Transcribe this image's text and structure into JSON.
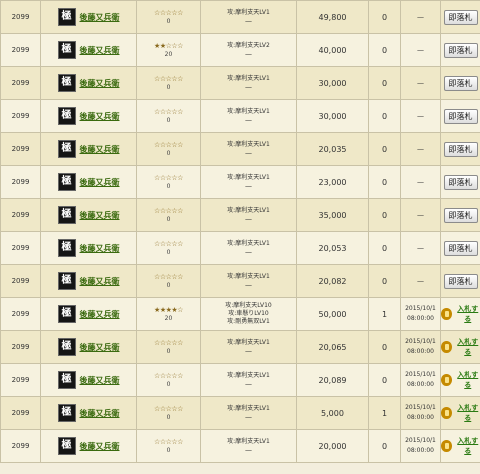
{
  "card_glyph": "極",
  "card_name": "後藤又兵衛",
  "buy_label": "即落札",
  "bid_label": "入札する",
  "rows": [
    {
      "id": "2099",
      "stars": "☆☆☆☆☆",
      "star_count": "0",
      "skills": [
        "攻:摩利支天LV1"
      ],
      "skill_extra": "—",
      "price": "49,800",
      "bids": "0",
      "deadline": "—",
      "deadline_time": "",
      "action": "buy"
    },
    {
      "id": "2099",
      "stars": "★★☆☆☆",
      "star_count": "20",
      "skills": [
        "攻:摩利支天LV2"
      ],
      "skill_extra": "—",
      "price": "40,000",
      "bids": "0",
      "deadline": "—",
      "deadline_time": "",
      "action": "buy"
    },
    {
      "id": "2099",
      "stars": "☆☆☆☆☆",
      "star_count": "0",
      "skills": [
        "攻:摩利支天LV1"
      ],
      "skill_extra": "—",
      "price": "30,000",
      "bids": "0",
      "deadline": "—",
      "deadline_time": "",
      "action": "buy"
    },
    {
      "id": "2099",
      "stars": "☆☆☆☆☆",
      "star_count": "0",
      "skills": [
        "攻:摩利支天LV1"
      ],
      "skill_extra": "—",
      "price": "30,000",
      "bids": "0",
      "deadline": "—",
      "deadline_time": "",
      "action": "buy"
    },
    {
      "id": "2099",
      "stars": "☆☆☆☆☆",
      "star_count": "0",
      "skills": [
        "攻:摩利支天LV1"
      ],
      "skill_extra": "—",
      "price": "20,035",
      "bids": "0",
      "deadline": "—",
      "deadline_time": "",
      "action": "buy"
    },
    {
      "id": "2099",
      "stars": "☆☆☆☆☆",
      "star_count": "0",
      "skills": [
        "攻:摩利支天LV1"
      ],
      "skill_extra": "—",
      "price": "23,000",
      "bids": "0",
      "deadline": "—",
      "deadline_time": "",
      "action": "buy"
    },
    {
      "id": "2099",
      "stars": "☆☆☆☆☆",
      "star_count": "0",
      "skills": [
        "攻:摩利支天LV1"
      ],
      "skill_extra": "—",
      "price": "35,000",
      "bids": "0",
      "deadline": "—",
      "deadline_time": "",
      "action": "buy"
    },
    {
      "id": "2099",
      "stars": "☆☆☆☆☆",
      "star_count": "0",
      "skills": [
        "攻:摩利支天LV1"
      ],
      "skill_extra": "—",
      "price": "20,053",
      "bids": "0",
      "deadline": "—",
      "deadline_time": "",
      "action": "buy"
    },
    {
      "id": "2099",
      "stars": "☆☆☆☆☆",
      "star_count": "0",
      "skills": [
        "攻:摩利支天LV1"
      ],
      "skill_extra": "—",
      "price": "20,082",
      "bids": "0",
      "deadline": "—",
      "deadline_time": "",
      "action": "buy"
    },
    {
      "id": "2099",
      "stars": "★★★★☆",
      "star_count": "20",
      "skills": [
        "攻:摩利支天LV10",
        "攻:車懸りLV10",
        "攻:剛勇無双LV1"
      ],
      "skill_extra": "",
      "price": "50,000",
      "bids": "1",
      "deadline": "2015/10/1",
      "deadline_time": "08:00:00",
      "action": "bid"
    },
    {
      "id": "2099",
      "stars": "☆☆☆☆☆",
      "star_count": "0",
      "skills": [
        "攻:摩利支天LV1"
      ],
      "skill_extra": "—",
      "price": "20,065",
      "bids": "0",
      "deadline": "2015/10/1",
      "deadline_time": "08:00:00",
      "action": "bid"
    },
    {
      "id": "2099",
      "stars": "☆☆☆☆☆",
      "star_count": "0",
      "skills": [
        "攻:摩利支天LV1"
      ],
      "skill_extra": "—",
      "price": "20,089",
      "bids": "0",
      "deadline": "2015/10/1",
      "deadline_time": "08:00:00",
      "action": "bid"
    },
    {
      "id": "2099",
      "stars": "☆☆☆☆☆",
      "star_count": "0",
      "skills": [
        "攻:摩利支天LV1"
      ],
      "skill_extra": "—",
      "price": "5,000",
      "bids": "1",
      "deadline": "2015/10/1",
      "deadline_time": "08:00:00",
      "action": "bid"
    },
    {
      "id": "2099",
      "stars": "☆☆☆☆☆",
      "star_count": "0",
      "skills": [
        "攻:摩利支天LV1"
      ],
      "skill_extra": "—",
      "price": "20,000",
      "bids": "0",
      "deadline": "2015/10/1",
      "deadline_time": "08:00:00",
      "action": "bid"
    }
  ]
}
